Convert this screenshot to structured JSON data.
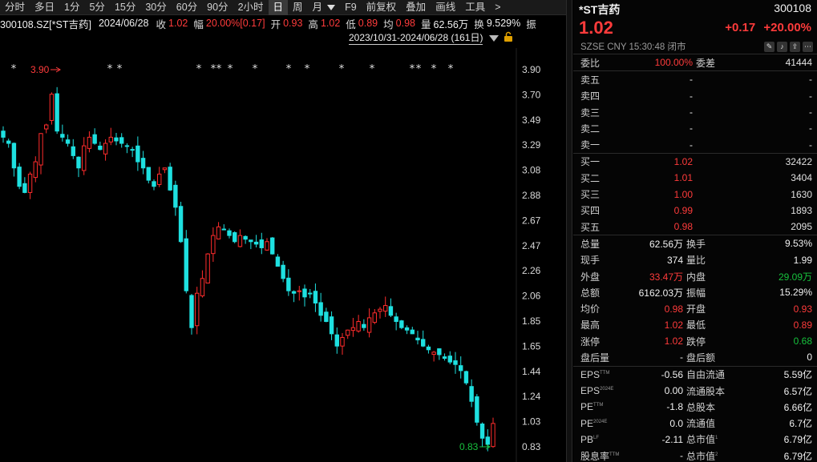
{
  "toolbar": {
    "items": [
      "分时",
      "多日",
      "1分",
      "5分",
      "15分",
      "30分",
      "60分",
      "90分",
      "2小时",
      "日",
      "周",
      "月",
      "F9",
      "前复权",
      "叠加",
      "画线",
      "工具",
      ">"
    ],
    "active": "日"
  },
  "info": {
    "code_name": "300108.SZ[*ST吉药]",
    "date": "2024/06/28",
    "close_label": "收",
    "close": "1.02",
    "range_label": "幅",
    "range": "20.00%[0.17]",
    "open_label": "开",
    "open": "0.93",
    "high_label": "高",
    "high": "1.02",
    "low_label": "低",
    "low": "0.89",
    "avg_label": "均",
    "avg": "0.98",
    "vol_label": "量",
    "vol": "62.56万",
    "turn_label": "换",
    "turn": "9.529%",
    "amp_label": "振"
  },
  "date_range": "2023/10/31-2024/06/28 (161日)",
  "chart_data": {
    "type": "candlestick",
    "y_ticks": [
      "3.90",
      "3.70",
      "3.49",
      "3.29",
      "3.08",
      "2.88",
      "2.67",
      "2.47",
      "2.26",
      "2.06",
      "1.85",
      "1.65",
      "1.44",
      "1.24",
      "1.03",
      "0.83"
    ],
    "ylim": [
      0.83,
      3.9
    ],
    "high_marker": "3.90",
    "low_marker": "0.83",
    "event_marker": "*",
    "up_color": "#ff2c2c",
    "down_color": "#1ee0e0",
    "close_series": [
      3.35,
      3.3,
      3.1,
      2.95,
      2.9,
      3.05,
      3.15,
      3.38,
      3.45,
      3.7,
      3.4,
      3.35,
      3.3,
      3.2,
      3.1,
      3.28,
      3.35,
      3.3,
      3.25,
      3.3,
      3.35,
      3.32,
      3.3,
      3.28,
      3.25,
      3.15,
      3.1,
      3.0,
      2.95,
      3.05,
      3.1,
      2.92,
      2.78,
      2.5,
      2.1,
      1.8,
      2.08,
      2.2,
      2.4,
      2.55,
      2.62,
      2.6,
      2.55,
      2.5,
      2.55,
      2.52,
      2.5,
      2.48,
      2.45,
      2.5,
      2.4,
      2.3,
      2.2,
      2.1,
      2.08,
      2.1,
      2.05,
      2.08,
      2.0,
      1.9,
      1.85,
      1.75,
      1.65,
      1.72,
      1.78,
      1.8,
      1.85,
      1.8,
      1.88,
      1.92,
      1.95,
      1.98,
      1.9,
      1.85,
      1.8,
      1.78,
      1.75,
      1.7,
      1.65,
      1.62,
      1.6,
      1.58,
      1.55,
      1.52,
      1.5,
      1.45,
      1.35,
      1.2,
      1.03,
      0.9,
      0.85,
      1.02
    ],
    "star_count": 16
  },
  "panel": {
    "name": "*ST吉药",
    "code": "300108",
    "price": "1.02",
    "change": "+0.17",
    "change_pct": "+20.00%",
    "meta": "SZSE  CNY  15:30:48  闭市",
    "wei": {
      "l1": "委比",
      "v1": "100.00%",
      "l2": "委差",
      "v2": "41444"
    },
    "asks": [
      {
        "label": "卖五",
        "price": "-",
        "vol": "-"
      },
      {
        "label": "卖四",
        "price": "-",
        "vol": "-"
      },
      {
        "label": "卖三",
        "price": "-",
        "vol": "-"
      },
      {
        "label": "卖二",
        "price": "-",
        "vol": "-"
      },
      {
        "label": "卖一",
        "price": "-",
        "vol": "-"
      }
    ],
    "bids": [
      {
        "label": "买一",
        "price": "1.02",
        "vol": "32422"
      },
      {
        "label": "买二",
        "price": "1.01",
        "vol": "3404"
      },
      {
        "label": "买三",
        "price": "1.00",
        "vol": "1630"
      },
      {
        "label": "买四",
        "price": "0.99",
        "vol": "1893"
      },
      {
        "label": "买五",
        "price": "0.98",
        "vol": "2095"
      }
    ],
    "stats": [
      {
        "l1": "总量",
        "v1": "62.56万",
        "c1": "white",
        "l2": "换手",
        "v2": "9.53%",
        "c2": "white"
      },
      {
        "l1": "现手",
        "v1": "374",
        "c1": "white",
        "l2": "量比",
        "v2": "1.99",
        "c2": "white"
      },
      {
        "l1": "外盘",
        "v1": "33.47万",
        "c1": "red",
        "l2": "内盘",
        "v2": "29.09万",
        "c2": "green"
      },
      {
        "l1": "总额",
        "v1": "6162.03万",
        "c1": "white",
        "l2": "振幅",
        "v2": "15.29%",
        "c2": "white"
      },
      {
        "l1": "均价",
        "v1": "0.98",
        "c1": "red",
        "l2": "开盘",
        "v2": "0.93",
        "c2": "red"
      },
      {
        "l1": "最高",
        "v1": "1.02",
        "c1": "red",
        "l2": "最低",
        "v2": "0.89",
        "c2": "red"
      },
      {
        "l1": "涨停",
        "v1": "1.02",
        "c1": "red",
        "l2": "跌停",
        "v2": "0.68",
        "c2": "green"
      },
      {
        "l1": "盘后量",
        "v1": "-",
        "c1": "white",
        "l2": "盘后额",
        "v2": "0",
        "c2": "white"
      }
    ],
    "fund": [
      {
        "l1": "EPS",
        "s1": "TTM",
        "v1": "-0.56",
        "l2": "自由流通",
        "s2": "",
        "v2": "5.59亿"
      },
      {
        "l1": "EPS",
        "s1": "2024E",
        "v1": "0.00",
        "l2": "流通股本",
        "s2": "",
        "v2": "6.57亿"
      },
      {
        "l1": "PE",
        "s1": "TTM",
        "v1": "-1.8",
        "l2": "总股本",
        "s2": "",
        "v2": "6.66亿"
      },
      {
        "l1": "PE",
        "s1": "2024E",
        "v1": "0.0",
        "l2": "流通值",
        "s2": "",
        "v2": "6.7亿"
      },
      {
        "l1": "PB",
        "s1": "LF",
        "v1": "-2.11",
        "l2": "总市值",
        "s2": "1",
        "v2": "6.79亿"
      },
      {
        "l1": "股息率",
        "s1": "TTM",
        "v1": "-",
        "l2": "总市值",
        "s2": "2",
        "v2": "6.79亿"
      }
    ]
  }
}
